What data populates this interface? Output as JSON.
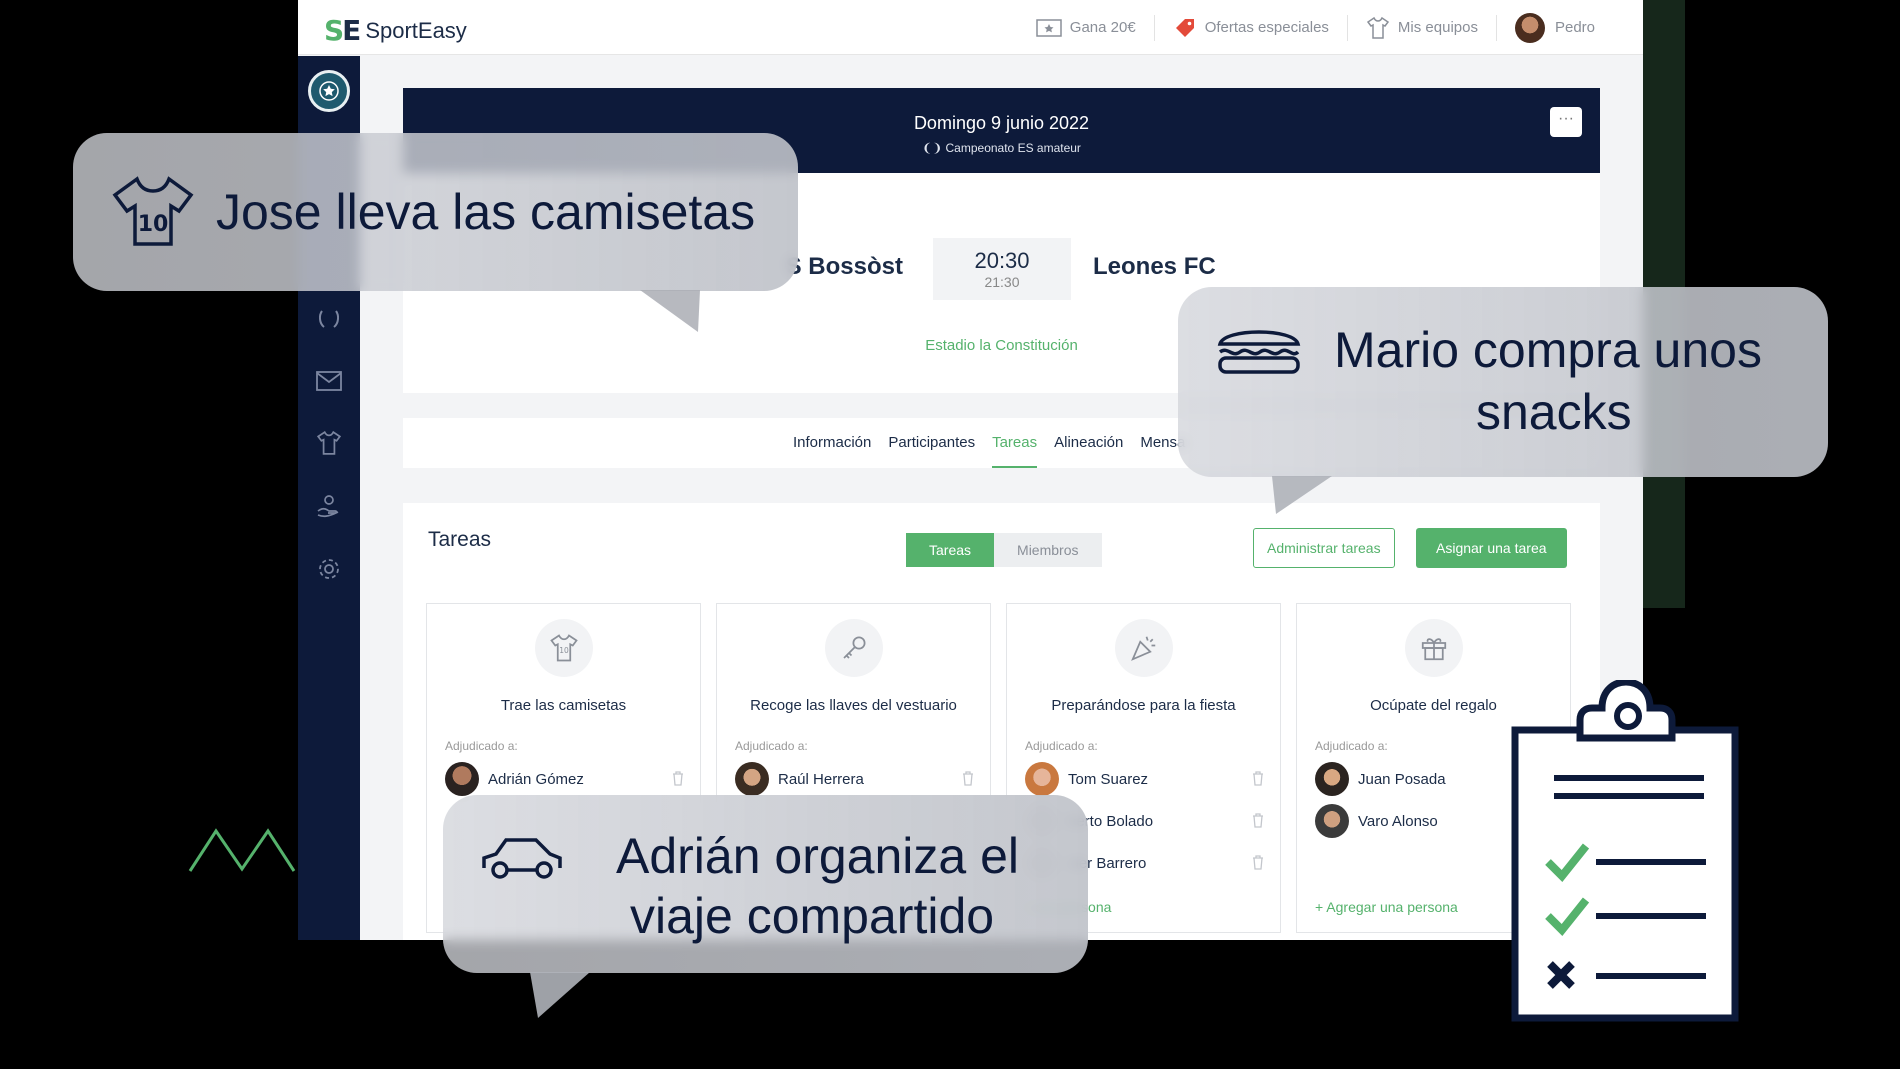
{
  "app": {
    "logo_mark_s": "S",
    "logo_mark_e": "E",
    "logo_text": "SportEasy"
  },
  "topnav": {
    "earn": "Gana 20€",
    "offers": "Ofertas especiales",
    "teams": "Mis equipos",
    "user": "Pedro"
  },
  "sidebar": {
    "icons": [
      "trophy-icon",
      "mail-icon",
      "jersey-icon",
      "donation-icon",
      "gear-icon"
    ]
  },
  "match": {
    "date": "Domingo 9 junio 2022",
    "competition": "Campeonato ES amateur",
    "more": "···",
    "home_team": "S Bossòst",
    "time": "20:30",
    "end_time": "21:30",
    "away_team": "Leones FC",
    "venue": "Estadio la Constitución"
  },
  "tabs": [
    {
      "label": "Información"
    },
    {
      "label": "Participantes"
    },
    {
      "label": "Tareas"
    },
    {
      "label": "Alineación"
    },
    {
      "label": "Mensa"
    }
  ],
  "tasks": {
    "title": "Tareas",
    "seg_tasks": "Tareas",
    "seg_members": "Miembros",
    "manage": "Administrar tareas",
    "assign": "Asignar una tarea",
    "assigned_label": "Adjudicado a:",
    "cards": [
      {
        "title": "Trae las camisetas",
        "icon": "jersey-icon",
        "people": [
          "Adrián Gómez"
        ]
      },
      {
        "title": "Recoge las llaves del vestuario",
        "icon": "key-icon",
        "people": [
          "Raúl Herrera"
        ]
      },
      {
        "title": "Preparándose para la fiesta",
        "icon": "party-icon",
        "people": [
          "Tom Suarez",
          "berto Bolado",
          "vier Barrero"
        ],
        "add": "r una persona"
      },
      {
        "title": "Ocúpate del regalo",
        "icon": "gift-icon",
        "people": [
          "Juan Posada",
          "Varo Alonso"
        ],
        "add": "+ Agregar una persona"
      }
    ]
  },
  "callouts": {
    "jose": "Jose lleva las camisetas",
    "mario_1": "Mario compra unos",
    "mario_2": "snacks",
    "adrian_1": "Adrián organiza el",
    "adrian_2": "viaje compartido"
  },
  "colors": {
    "brand_green": "#55b26c",
    "navy": "#0d1a3a"
  }
}
